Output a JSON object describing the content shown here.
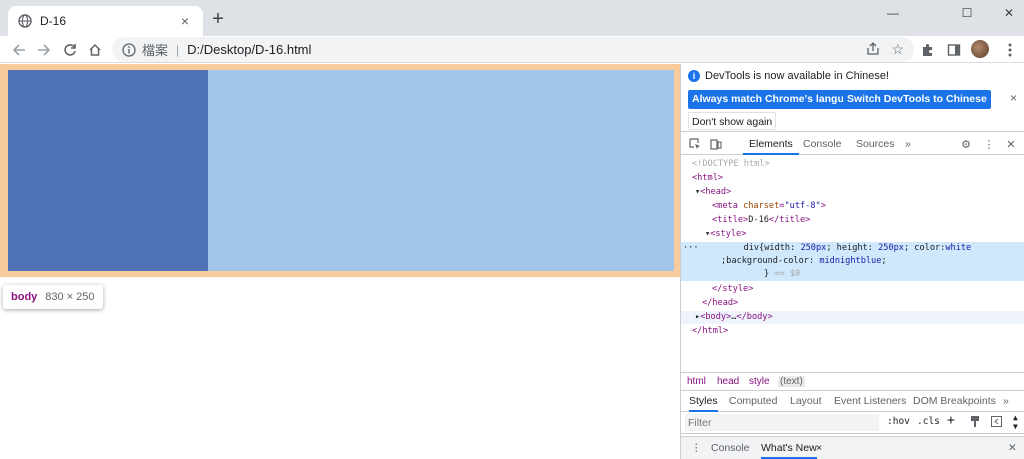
{
  "browser": {
    "tab_title": "D-16",
    "tab_close": "×",
    "new_tab": "+",
    "window_controls": [
      "—",
      "☐",
      "✕"
    ],
    "address_scheme": "檔案",
    "address_url": "D:/Desktop/D-16.html"
  },
  "page": {
    "tooltip_tag": "body",
    "tooltip_dims": "830 × 250",
    "colors": {
      "body_highlight": "#f8cb9c",
      "div_dark": "#4e73b6",
      "div_light": "#a0c5e8"
    }
  },
  "devtools": {
    "infobar": {
      "message": "DevTools is now available in Chinese!",
      "btn_match": "Always match Chrome's language",
      "btn_switch": "Switch DevTools to Chinese",
      "btn_dont_show": "Don't show again",
      "close": "×"
    },
    "tabs": {
      "elements": "Elements",
      "console": "Console",
      "sources": "Sources",
      "more": "»"
    },
    "dom": {
      "doctype": "<!DOCTYPE html>",
      "html_open": "<html>",
      "head_open": "<head>",
      "meta_tag": "<meta",
      "meta_attr": "charset",
      "meta_val": "\"utf-8\"",
      "meta_close": ">",
      "title_open": "<title>",
      "title_text": "D-16",
      "title_close": "</title>",
      "style_open": "<style>",
      "css_line1_a": "div{width: ",
      "css_line1_b": "250px",
      "css_line1_c": "; height: ",
      "css_line1_d": "250px",
      "css_line1_e": "; color:",
      "css_line1_f": "white",
      "css_line2_a": ";background-color: ",
      "css_line2_b": "midnightblue",
      "css_line2_c": ";",
      "css_line3_a": "} ",
      "css_line3_b": "== $0",
      "style_close": "</style>",
      "head_close": "</head>",
      "body_collapsed_a": "<body>",
      "body_collapsed_b": "…",
      "body_collapsed_c": "</body>",
      "html_close": "</html>",
      "ellipsis": "···"
    },
    "breadcrumbs": [
      "html",
      "head",
      "style",
      "(text)"
    ],
    "subtabs": [
      "Styles",
      "Computed",
      "Layout",
      "Event Listeners",
      "DOM Breakpoints",
      "»"
    ],
    "filter": {
      "placeholder": "Filter",
      "hov": ":hov",
      "cls": ".cls",
      "plus": "+"
    },
    "drawer": {
      "menu": "⋮",
      "console": "Console",
      "whats_new": "What's New",
      "close": "×"
    }
  }
}
